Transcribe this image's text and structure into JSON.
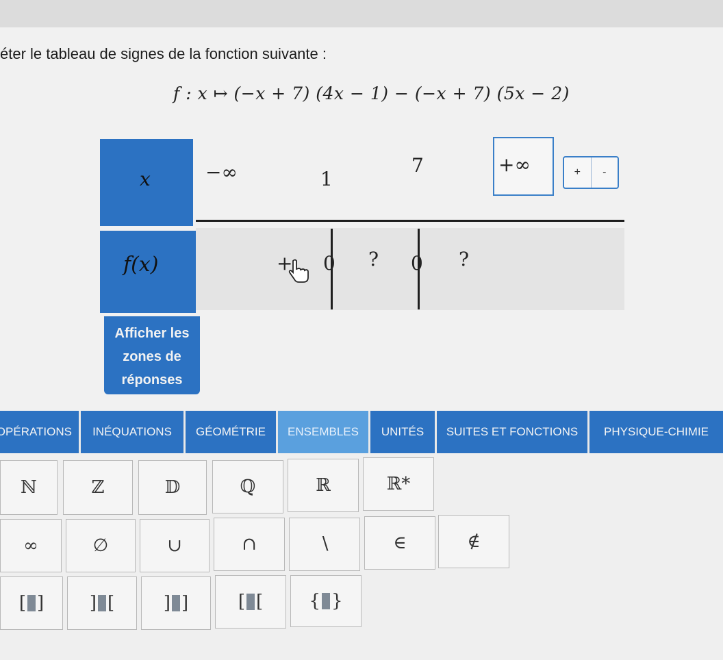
{
  "instruction": "éter le tableau de signes de la fonction suivante :",
  "formula": "f : x ↦ (−x + 7) (4x − 1) − (−x + 7) (5x − 2)",
  "table": {
    "x_label": "x",
    "fx_label": "f(x)",
    "x_values": [
      "−∞",
      "1",
      "7",
      "+∞"
    ],
    "signs": [
      "+",
      "0",
      "?",
      "0",
      "?"
    ]
  },
  "sign_picker": {
    "plus": "+",
    "minus": "-"
  },
  "show_answers_button": [
    "Afficher les",
    "zones de",
    "réponses"
  ],
  "colors": {
    "primary": "#2c72c2",
    "active_tab": "#5aa0de",
    "background": "#f1f1f1"
  },
  "categories": [
    "OPÉRATIONS",
    "INÉQUATIONS",
    "GÉOMÉTRIE",
    "ENSEMBLES",
    "UNITÉS",
    "SUITES ET FONCTIONS",
    "PHYSIQUE-CHIMIE"
  ],
  "active_category": "ENSEMBLES",
  "keys": {
    "row1": [
      "ℕ",
      "ℤ",
      "𝔻",
      "ℚ",
      "ℝ",
      "ℝ*"
    ],
    "row2": [
      "∞",
      "∅",
      "∪",
      "∩",
      "∖",
      "∈",
      "∉"
    ],
    "row3": [
      [
        "[",
        "]"
      ],
      [
        "]",
        "["
      ],
      [
        "]",
        "]"
      ],
      [
        "[",
        "["
      ],
      [
        "{",
        "}"
      ]
    ]
  }
}
